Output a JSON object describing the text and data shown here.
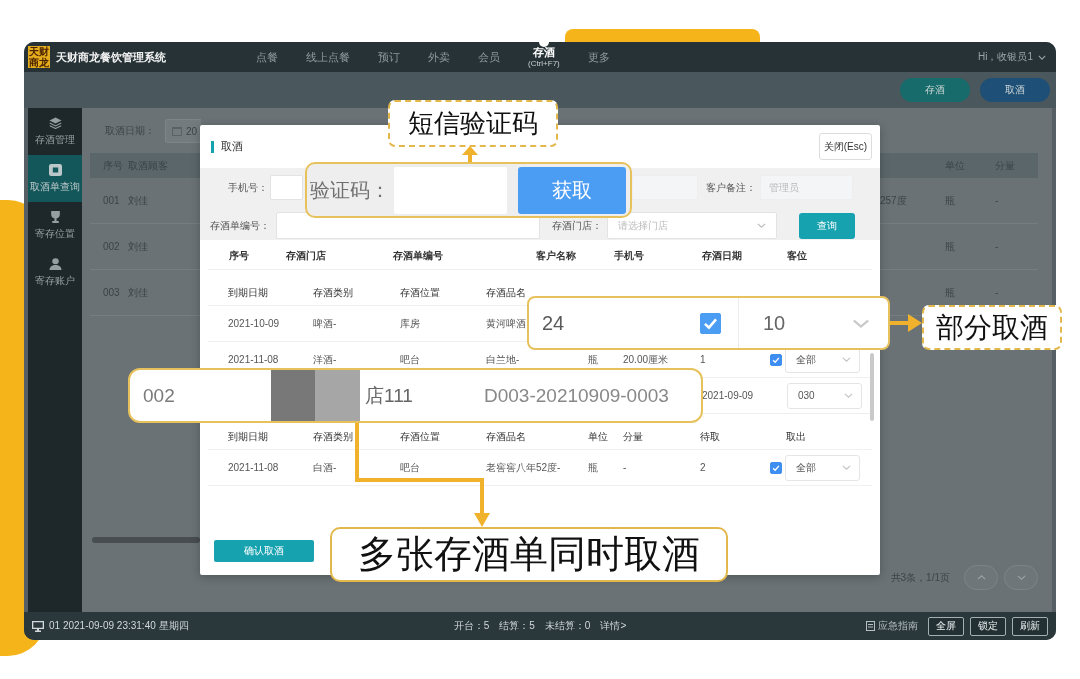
{
  "topbar": {
    "logo": "天财商龙",
    "title": "天财商龙餐饮管理系统",
    "nav": [
      {
        "label": "点餐",
        "selected": false
      },
      {
        "label": "线上点餐",
        "selected": false
      },
      {
        "label": "预订",
        "selected": false
      },
      {
        "label": "外卖",
        "selected": false
      },
      {
        "label": "会员",
        "selected": false
      },
      {
        "label": "存酒",
        "shortcut": "(Ctrl+F7)",
        "selected": true
      },
      {
        "label": "更多",
        "selected": false
      }
    ],
    "user": "Hi，收银员1"
  },
  "actions": [
    {
      "label": "存酒",
      "color": "#176b6a"
    },
    {
      "label": "取酒",
      "color": "#1e4f76"
    }
  ],
  "sidebar": {
    "items": [
      {
        "label": "存酒管理",
        "selected": false
      },
      {
        "label": "取酒单查询",
        "selected": true
      },
      {
        "label": "寄存位置",
        "selected": false
      },
      {
        "label": "寄存账户",
        "selected": false
      }
    ]
  },
  "filter": {
    "label": "取酒日期：",
    "value": "20"
  },
  "table": {
    "columns": [
      "序号",
      "取酒顾客",
      "单位",
      "分量"
    ],
    "rows": [
      {
        "number": "001",
        "customer": "刘佳",
        "column_3": "257度",
        "unit": "瓶",
        "amount": "-"
      },
      {
        "number": "002",
        "customer": "刘佳",
        "unit": "瓶",
        "amount": "-"
      },
      {
        "number": "003",
        "customer": "刘佳",
        "unit": "瓶",
        "amount": "-"
      }
    ]
  },
  "pager": {
    "summary": "共3条，1/1页"
  },
  "status_bar": {
    "terminal": "01 2021-09-09 23:31:40 星期四",
    "stats": [
      "开台：5",
      "结算：5",
      "未结算：0"
    ],
    "details_link": "详情>",
    "guide": "应急指南",
    "buttons": [
      "全屏",
      "锁定",
      "刷新"
    ]
  },
  "modal": {
    "title": "取酒",
    "close_button": "关闭(Esc)",
    "form": {
      "phone_label": "手机号：",
      "remark_label": "客户备注：",
      "remark_placeholder": "管理员",
      "order_no_label": "存酒单编号：",
      "store_label": "存酒门店：",
      "store_placeholder": "请选择门店",
      "query_button": "查询"
    },
    "table": {
      "columns": [
        "序号",
        "存酒门店",
        "存酒单编号",
        "客户名称",
        "手机号",
        "存酒日期",
        "客位"
      ],
      "sections": [
        {
          "kind": "items",
          "columns": [
            "到期日期",
            "存酒类别",
            "存酒位置",
            "存酒品名"
          ],
          "rows": [
            {
              "cells": [
                "2021-10-09",
                "啤酒-",
                "库房",
                "黄河啤酒"
              ]
            },
            {
              "cells": [
                "2021-11-08",
                "洋酒-",
                "吧台",
                "白兰地-",
                "瓶",
                "20.00厘米",
                "1"
              ],
              "checked": true,
              "take": "全部"
            }
          ]
        },
        {
          "kind": "order",
          "date": "2021-09-09",
          "seat": "030"
        },
        {
          "kind": "items",
          "columns": [
            "到期日期",
            "存酒类别",
            "存酒位置",
            "存酒品名",
            "单位",
            "分量",
            "待取",
            "取出"
          ],
          "rows": [
            {
              "cells": [
                "2021-11-08",
                "白酒-",
                "吧台",
                "老窖窖八年52度-",
                "瓶",
                "-",
                "2"
              ],
              "checked": true,
              "take": "全部"
            }
          ]
        }
      ]
    },
    "confirm_button": "确认取酒"
  },
  "callouts": [
    {
      "kind": "sms",
      "label": "短信验证码",
      "field_label": "验证码：",
      "button": "获取"
    },
    {
      "kind": "partial",
      "label": "部分取酒",
      "quantity": "24",
      "checked": true,
      "take": "10"
    },
    {
      "kind": "multi",
      "label": "多张存酒单同时取酒",
      "number": "002",
      "store": "店111",
      "order_no": "D003-20210909-0003"
    }
  ]
}
